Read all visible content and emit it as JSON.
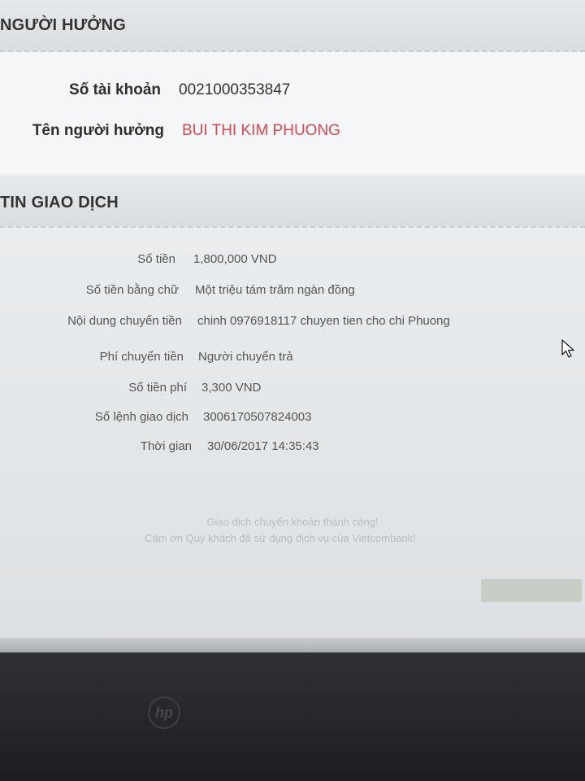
{
  "beneficiary": {
    "section_title": "NGƯỜI HƯỞNG",
    "account_number_label": "Số tài khoản",
    "account_number": "0021000353847",
    "beneficiary_name_label": "Tên người hưởng",
    "beneficiary_name": "BUI THI KIM PHUONG"
  },
  "transaction": {
    "section_title": "TIN GIAO DỊCH",
    "amount_label": "Số tiền",
    "amount": "1,800,000 VND",
    "amount_words_label": "Số tiền bằng chữ",
    "amount_words": "Một triệu tám trăm ngàn đồng",
    "content_label": "Nội dung chuyển tiền",
    "content": "chinh 0976918117 chuyen tien cho chi Phuong",
    "fee_type_label": "Phí chuyển tiền",
    "fee_type": "Người chuyển trả",
    "fee_amount_label": "Số tiền phí",
    "fee_amount": "3,300 VND",
    "order_number_label": "Số lệnh giao dịch",
    "order_number": "3006170507824003",
    "time_label": "Thời gian",
    "time": "30/06/2017 14:35:43"
  },
  "result": {
    "success_message": "Giao dịch chuyển khoản thành công!",
    "thanks_message": "Cảm ơn Quý khách đã sử dụng dịch vụ của Vietcombank!"
  },
  "laptop": {
    "brand_logo": "hp"
  },
  "colors": {
    "accent_red": "#d7484e",
    "header_bg": "#dde1e3"
  }
}
